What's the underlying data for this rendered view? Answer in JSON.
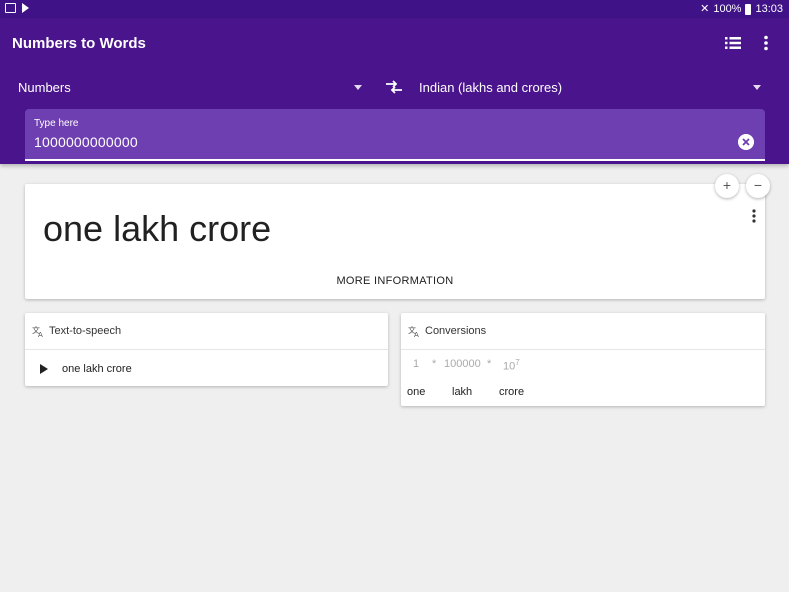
{
  "status_bar": {
    "battery": "100%",
    "time": "13:03"
  },
  "app_bar": {
    "title": "Numbers to Words",
    "from_dropdown": "Numbers",
    "to_dropdown": "Indian (lakhs and crores)"
  },
  "input": {
    "label": "Type here",
    "value": "1000000000000"
  },
  "result": {
    "text": "one lakh crore",
    "more_info_label": "MORE INFORMATION",
    "zoom_in": "+",
    "zoom_out": "−"
  },
  "tts_card": {
    "title": "Text-to-speech",
    "text": "one lakh crore"
  },
  "conversions_card": {
    "title": "Conversions",
    "factors": [
      "1",
      "100000",
      "10"
    ],
    "operator": "*",
    "exponent": "7",
    "words": [
      "one",
      "lakh",
      "crore"
    ]
  },
  "colors": {
    "status_bar": "#3f1287",
    "app_bar": "#4a148c",
    "input_bg": "#6d3fb0",
    "background": "#efefef"
  }
}
